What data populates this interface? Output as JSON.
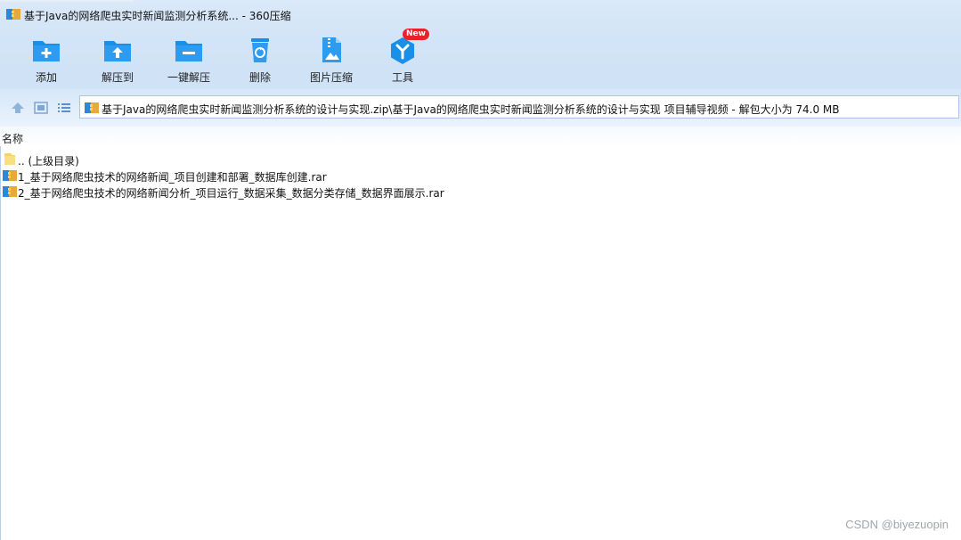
{
  "window": {
    "title": "基于Java的网络爬虫实时新闻监测分析系统... - 360压缩"
  },
  "toolbar": {
    "buttons": [
      {
        "label": "添加",
        "icon": "add-folder-icon"
      },
      {
        "label": "解压到",
        "icon": "extract-to-icon"
      },
      {
        "label": "一键解压",
        "icon": "one-click-extract-icon"
      },
      {
        "label": "删除",
        "icon": "recycle-delete-icon"
      },
      {
        "label": "图片压缩",
        "icon": "image-compress-icon"
      },
      {
        "label": "工具",
        "icon": "tools-icon",
        "badge": "New"
      }
    ]
  },
  "address": {
    "path": "基于Java的网络爬虫实时新闻监测分析系统的设计与实现.zip\\基于Java的网络爬虫实时新闻监测分析系统的设计与实现 项目辅导视频 - 解包大小为 74.0 MB"
  },
  "columns": {
    "name": "名称"
  },
  "files": [
    {
      "name": ".. (上级目录)",
      "type": "parent-folder"
    },
    {
      "name": "1_基于网络爬虫技术的网络新闻_项目创建和部署_数据库创建.rar",
      "type": "rar"
    },
    {
      "name": "2_基于网络爬虫技术的网络新闻分析_项目运行_数据采集_数据分类存储_数据界面展示.rar",
      "type": "rar"
    }
  ],
  "watermark": "CSDN @biyezuopin",
  "colors": {
    "accent": "#1a8fe8",
    "titlebar": "#d3e5f7",
    "badge": "#e8222b"
  }
}
